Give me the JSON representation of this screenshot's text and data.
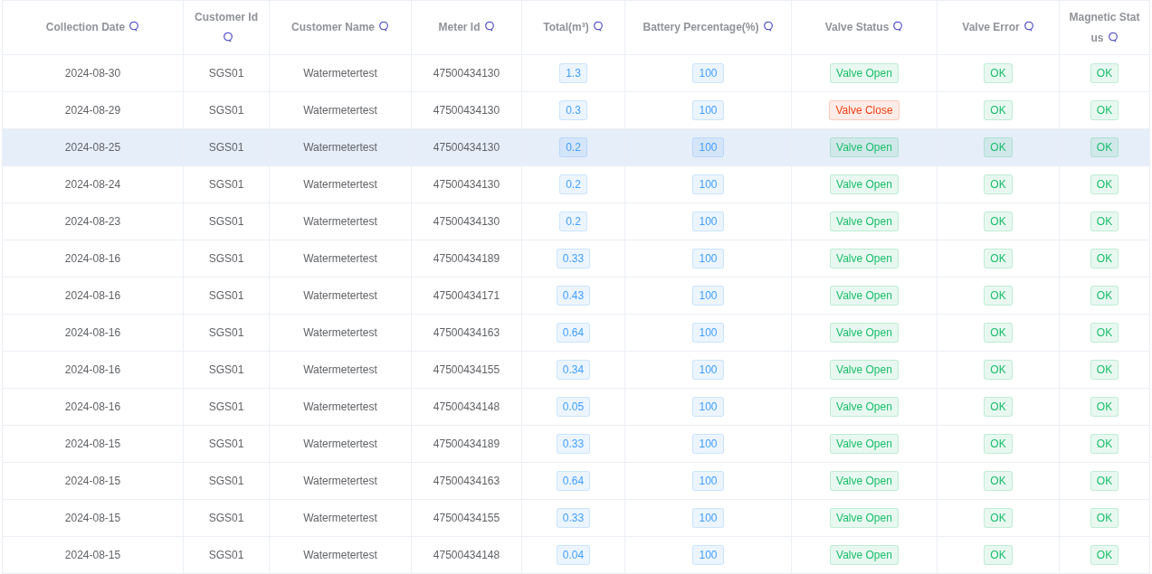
{
  "table": {
    "columns": [
      {
        "label": "Collection Date",
        "kind": "text"
      },
      {
        "label": "Customer Id",
        "kind": "text"
      },
      {
        "label": "Customer Name",
        "kind": "text"
      },
      {
        "label": "Meter Id",
        "kind": "text"
      },
      {
        "label": "Total(m³)",
        "kind": "tag"
      },
      {
        "label": "Battery Percentage(%)",
        "kind": "tag"
      },
      {
        "label": "Valve Status",
        "kind": "tag"
      },
      {
        "label": "Valve Error",
        "kind": "tag"
      },
      {
        "label": "Magnetic Status",
        "kind": "tag"
      }
    ],
    "rows": [
      {
        "highlighted": false,
        "cells": [
          {
            "text": "2024-08-30"
          },
          {
            "text": "SGS01"
          },
          {
            "text": "Watermetertest"
          },
          {
            "text": "47500434130"
          },
          {
            "text": "1.3",
            "color": "#409eff"
          },
          {
            "text": "100",
            "color": "#409eff"
          },
          {
            "text": "Valve Open",
            "color": "#19be6b"
          },
          {
            "text": "OK",
            "color": "#19be6b"
          },
          {
            "text": "OK",
            "color": "#19be6b"
          }
        ]
      },
      {
        "highlighted": false,
        "cells": [
          {
            "text": "2024-08-29"
          },
          {
            "text": "SGS01"
          },
          {
            "text": "Watermetertest"
          },
          {
            "text": "47500434130"
          },
          {
            "text": "0.3",
            "color": "#409eff"
          },
          {
            "text": "100",
            "color": "#409eff"
          },
          {
            "text": "Valve Close",
            "color": "#ed4014"
          },
          {
            "text": "OK",
            "color": "#19be6b"
          },
          {
            "text": "OK",
            "color": "#19be6b"
          }
        ]
      },
      {
        "highlighted": true,
        "cells": [
          {
            "text": "2024-08-25"
          },
          {
            "text": "SGS01"
          },
          {
            "text": "Watermetertest"
          },
          {
            "text": "47500434130"
          },
          {
            "text": "0.2",
            "color": "#409eff"
          },
          {
            "text": "100",
            "color": "#409eff"
          },
          {
            "text": "Valve Open",
            "color": "#19be6b"
          },
          {
            "text": "OK",
            "color": "#19be6b"
          },
          {
            "text": "OK",
            "color": "#19be6b"
          }
        ]
      },
      {
        "highlighted": false,
        "cells": [
          {
            "text": "2024-08-24"
          },
          {
            "text": "SGS01"
          },
          {
            "text": "Watermetertest"
          },
          {
            "text": "47500434130"
          },
          {
            "text": "0.2",
            "color": "#409eff"
          },
          {
            "text": "100",
            "color": "#409eff"
          },
          {
            "text": "Valve Open",
            "color": "#19be6b"
          },
          {
            "text": "OK",
            "color": "#19be6b"
          },
          {
            "text": "OK",
            "color": "#19be6b"
          }
        ]
      },
      {
        "highlighted": false,
        "cells": [
          {
            "text": "2024-08-23"
          },
          {
            "text": "SGS01"
          },
          {
            "text": "Watermetertest"
          },
          {
            "text": "47500434130"
          },
          {
            "text": "0.2",
            "color": "#409eff"
          },
          {
            "text": "100",
            "color": "#409eff"
          },
          {
            "text": "Valve Open",
            "color": "#19be6b"
          },
          {
            "text": "OK",
            "color": "#19be6b"
          },
          {
            "text": "OK",
            "color": "#19be6b"
          }
        ]
      },
      {
        "highlighted": false,
        "cells": [
          {
            "text": "2024-08-16"
          },
          {
            "text": "SGS01"
          },
          {
            "text": "Watermetertest"
          },
          {
            "text": "47500434189"
          },
          {
            "text": "0.33",
            "color": "#409eff"
          },
          {
            "text": "100",
            "color": "#409eff"
          },
          {
            "text": "Valve Open",
            "color": "#19be6b"
          },
          {
            "text": "OK",
            "color": "#19be6b"
          },
          {
            "text": "OK",
            "color": "#19be6b"
          }
        ]
      },
      {
        "highlighted": false,
        "cells": [
          {
            "text": "2024-08-16"
          },
          {
            "text": "SGS01"
          },
          {
            "text": "Watermetertest"
          },
          {
            "text": "47500434171"
          },
          {
            "text": "0.43",
            "color": "#409eff"
          },
          {
            "text": "100",
            "color": "#409eff"
          },
          {
            "text": "Valve Open",
            "color": "#19be6b"
          },
          {
            "text": "OK",
            "color": "#19be6b"
          },
          {
            "text": "OK",
            "color": "#19be6b"
          }
        ]
      },
      {
        "highlighted": false,
        "cells": [
          {
            "text": "2024-08-16"
          },
          {
            "text": "SGS01"
          },
          {
            "text": "Watermetertest"
          },
          {
            "text": "47500434163"
          },
          {
            "text": "0.64",
            "color": "#409eff"
          },
          {
            "text": "100",
            "color": "#409eff"
          },
          {
            "text": "Valve Open",
            "color": "#19be6b"
          },
          {
            "text": "OK",
            "color": "#19be6b"
          },
          {
            "text": "OK",
            "color": "#19be6b"
          }
        ]
      },
      {
        "highlighted": false,
        "cells": [
          {
            "text": "2024-08-16"
          },
          {
            "text": "SGS01"
          },
          {
            "text": "Watermetertest"
          },
          {
            "text": "47500434155"
          },
          {
            "text": "0.34",
            "color": "#409eff"
          },
          {
            "text": "100",
            "color": "#409eff"
          },
          {
            "text": "Valve Open",
            "color": "#19be6b"
          },
          {
            "text": "OK",
            "color": "#19be6b"
          },
          {
            "text": "OK",
            "color": "#19be6b"
          }
        ]
      },
      {
        "highlighted": false,
        "cells": [
          {
            "text": "2024-08-16"
          },
          {
            "text": "SGS01"
          },
          {
            "text": "Watermetertest"
          },
          {
            "text": "47500434148"
          },
          {
            "text": "0.05",
            "color": "#409eff"
          },
          {
            "text": "100",
            "color": "#409eff"
          },
          {
            "text": "Valve Open",
            "color": "#19be6b"
          },
          {
            "text": "OK",
            "color": "#19be6b"
          },
          {
            "text": "OK",
            "color": "#19be6b"
          }
        ]
      },
      {
        "highlighted": false,
        "cells": [
          {
            "text": "2024-08-15"
          },
          {
            "text": "SGS01"
          },
          {
            "text": "Watermetertest"
          },
          {
            "text": "47500434189"
          },
          {
            "text": "0.33",
            "color": "#409eff"
          },
          {
            "text": "100",
            "color": "#409eff"
          },
          {
            "text": "Valve Open",
            "color": "#19be6b"
          },
          {
            "text": "OK",
            "color": "#19be6b"
          },
          {
            "text": "OK",
            "color": "#19be6b"
          }
        ]
      },
      {
        "highlighted": false,
        "cells": [
          {
            "text": "2024-08-15"
          },
          {
            "text": "SGS01"
          },
          {
            "text": "Watermetertest"
          },
          {
            "text": "47500434163"
          },
          {
            "text": "0.64",
            "color": "#409eff"
          },
          {
            "text": "100",
            "color": "#409eff"
          },
          {
            "text": "Valve Open",
            "color": "#19be6b"
          },
          {
            "text": "OK",
            "color": "#19be6b"
          },
          {
            "text": "OK",
            "color": "#19be6b"
          }
        ]
      },
      {
        "highlighted": false,
        "cells": [
          {
            "text": "2024-08-15"
          },
          {
            "text": "SGS01"
          },
          {
            "text": "Watermetertest"
          },
          {
            "text": "47500434155"
          },
          {
            "text": "0.33",
            "color": "#409eff"
          },
          {
            "text": "100",
            "color": "#409eff"
          },
          {
            "text": "Valve Open",
            "color": "#19be6b"
          },
          {
            "text": "OK",
            "color": "#19be6b"
          },
          {
            "text": "OK",
            "color": "#19be6b"
          }
        ]
      },
      {
        "highlighted": false,
        "cells": [
          {
            "text": "2024-08-15"
          },
          {
            "text": "SGS01"
          },
          {
            "text": "Watermetertest"
          },
          {
            "text": "47500434148"
          },
          {
            "text": "0.04",
            "color": "#409eff"
          },
          {
            "text": "100",
            "color": "#409eff"
          },
          {
            "text": "Valve Open",
            "color": "#19be6b"
          },
          {
            "text": "OK",
            "color": "#19be6b"
          },
          {
            "text": "OK",
            "color": "#19be6b"
          }
        ]
      }
    ]
  }
}
